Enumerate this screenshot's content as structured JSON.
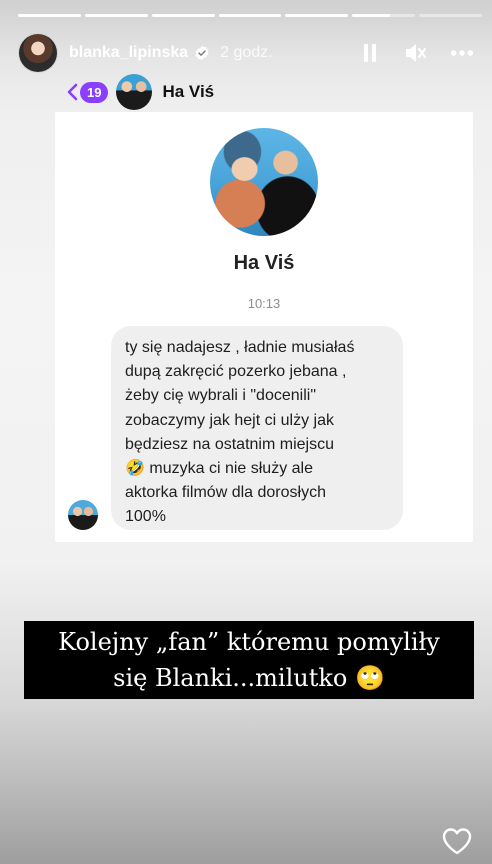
{
  "progress": [
    1,
    1,
    1,
    1,
    1,
    0.6,
    0
  ],
  "header": {
    "username": "blanka_lipinska",
    "time": "2 godz.",
    "verified_icon": "verified-badge-icon",
    "controls": [
      "pause-icon",
      "mute-icon",
      "more-icon"
    ]
  },
  "chat": {
    "back_count": "19",
    "name": "Ha Viś",
    "profile_name": "Ha Viś",
    "timestamp": "10:13",
    "message_lines": [
      "ty się nadajesz , ładnie musiałaś",
      "dupą zakręcić pozerko jebana ,",
      "żeby cię wybrali i \"docenili\"",
      "zobaczymy jak hejt ci ulży jak",
      "będziesz na ostatnim miejscu",
      "🤣 muzyka ci nie służy ale",
      "aktorka filmów dla dorosłych",
      "100%"
    ]
  },
  "caption": {
    "line1": "Kolejny „fan” któremu pomyliły",
    "line2": "się Blanki...milutko 🙄"
  },
  "colors": {
    "accent": "#8a3ffc",
    "bubble": "#efefef",
    "caption_bg": "#000000"
  }
}
